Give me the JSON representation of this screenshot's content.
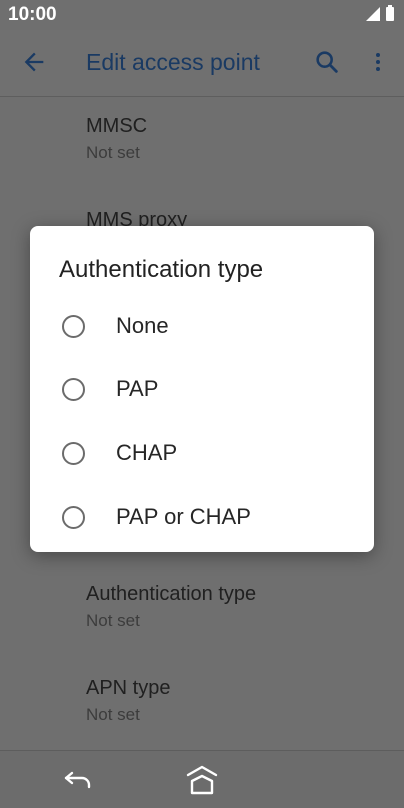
{
  "status_bar": {
    "time": "10:00",
    "icons": [
      "signal-icon",
      "battery-icon"
    ]
  },
  "app_bar": {
    "title": "Edit access point",
    "icons": [
      "back-arrow-icon",
      "search-icon",
      "more-vert-icon"
    ]
  },
  "background_list": {
    "items": [
      {
        "title": "MMSC",
        "summary": "Not set"
      },
      {
        "title": "MMS proxy",
        "summary": ""
      },
      {
        "title": "Authentication type",
        "summary": "Not set"
      },
      {
        "title": "APN type",
        "summary": "Not set"
      }
    ]
  },
  "dialog": {
    "title": "Authentication type",
    "options": [
      {
        "label": "None",
        "selected": false
      },
      {
        "label": "PAP",
        "selected": false
      },
      {
        "label": "CHAP",
        "selected": false
      },
      {
        "label": "PAP or CHAP",
        "selected": false
      }
    ]
  },
  "nav_bar": {
    "icons": [
      "nav-back-icon",
      "home-icon"
    ]
  },
  "colors": {
    "scrim": "#6f6f6f",
    "accent": "#1a3a63",
    "dialog_bg": "#ffffff"
  }
}
